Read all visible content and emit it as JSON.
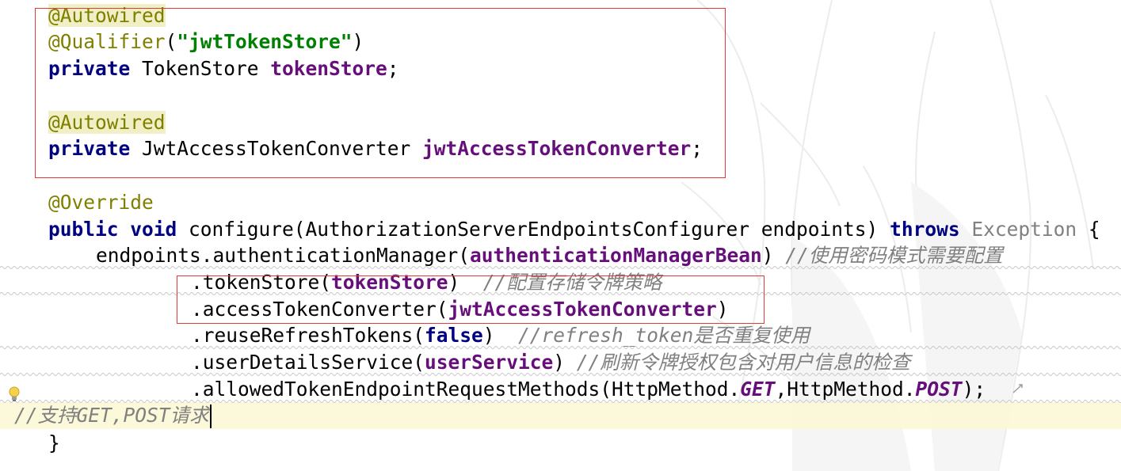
{
  "code": {
    "l1": {
      "ann": "@Autowired"
    },
    "l2": {
      "ann": "@Qualifier",
      "p1": "(",
      "str": "\"jwtTokenStore\"",
      "p2": ")"
    },
    "l3": {
      "kw": "private",
      "type": " TokenStore ",
      "fld": "tokenStore",
      "end": ";"
    },
    "l4": {
      "ann": "@Autowired"
    },
    "l5": {
      "kw": "private",
      "type": " JwtAccessTokenConverter ",
      "fld": "jwtAccessTokenConverter",
      "end": ";"
    },
    "l6": {
      "ann": "@Override"
    },
    "l7": {
      "kw1": "public",
      "kw2": "void",
      "sig": " configure(AuthorizationServerEndpointsConfigurer endpoints) ",
      "kw3": "throws",
      "exc": " Exception",
      "brace": " {"
    },
    "l8": {
      "pre": "endpoints.authenticationManager(",
      "fld": "authenticationManagerBean",
      "post": ") ",
      "cmt": "//使用密码模式需要配置"
    },
    "l9": {
      "pre": ".tokenStore(",
      "fld": "tokenStore",
      "post": ")  ",
      "cmt": "//配置存储令牌策略"
    },
    "l10": {
      "pre": ".accessTokenConverter(",
      "fld": "jwtAccessTokenConverter",
      "post": ")"
    },
    "l11": {
      "pre": ".reuseRefreshTokens(",
      "kw": "false",
      "post": ")  ",
      "cmt": "//refresh_token是否重复使用"
    },
    "l12": {
      "pre": ".userDetailsService(",
      "fld": "userService",
      "post": ") ",
      "cmt": "//刷新令牌授权包含对用户信息的检查"
    },
    "l13": {
      "pre": ".allowedTokenEndpointRequestMethods(HttpMethod.",
      "s1": "GET",
      "mid": ",HttpMethod.",
      "s2": "POST",
      "post": ");"
    },
    "l14": {
      "cmt": "//支持GET,POST请求"
    },
    "l15": {
      "brace": "}"
    }
  },
  "icons": {
    "gutter": "lightbulb-icon",
    "fold": "soft-wrap-icon"
  },
  "colors": {
    "keyword": "#000080",
    "annotation": "#808000",
    "string": "#008000",
    "field": "#660e7a",
    "comment": "#808080",
    "highlight_box": "#e53935",
    "caret_row": "#fcf8d6"
  }
}
